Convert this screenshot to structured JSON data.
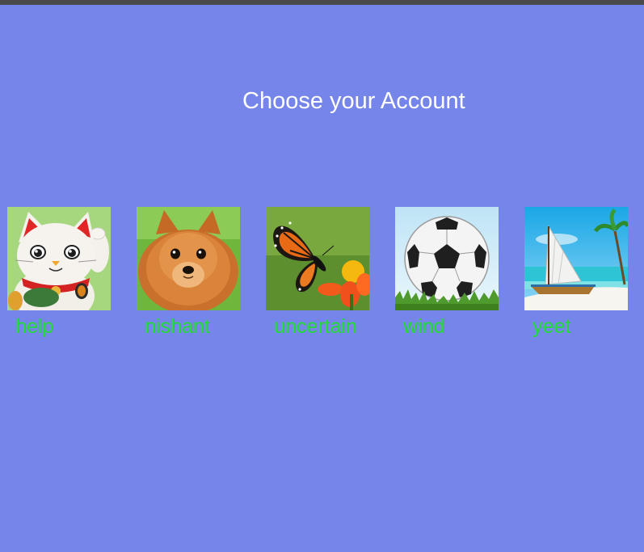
{
  "page": {
    "title": "Choose your Account",
    "background_color": "#7685EA",
    "name_color": "#22DD33"
  },
  "accounts": [
    {
      "name": "help",
      "avatar_icon": "lucky-cat-icon"
    },
    {
      "name": "nishant",
      "avatar_icon": "pomeranian-dog-icon"
    },
    {
      "name": "uncertain",
      "avatar_icon": "butterfly-flower-icon"
    },
    {
      "name": "wind",
      "avatar_icon": "soccer-ball-icon"
    },
    {
      "name": "yeet",
      "avatar_icon": "sailboat-beach-icon"
    }
  ]
}
